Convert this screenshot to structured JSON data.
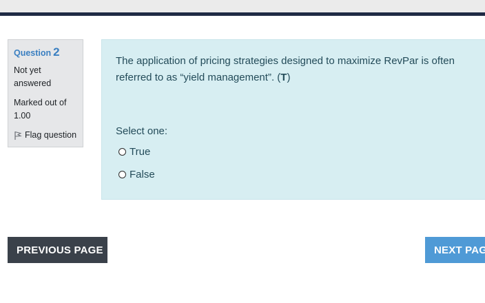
{
  "question": {
    "label": "Question",
    "number": "2",
    "state": "Not yet answered",
    "grade": "Marked out of 1.00",
    "flag_label": "Flag question",
    "text_main": "The application of pricing strategies designed to maximize RevPar is often referred to as “yield management”. (",
    "text_bold": "T",
    "text_end": ")",
    "prompt": "Select one:",
    "answers": [
      {
        "label": "True"
      },
      {
        "label": "False"
      }
    ]
  },
  "nav": {
    "prev_label": "PREVIOUS PAGE",
    "next_label": "NEXT PAGE"
  },
  "colors": {
    "accent": "#3a7fc1",
    "content_bg": "#d7eef2",
    "nav_prev": "#3a414a",
    "nav_next": "#4f9ad6",
    "header_bar": "#1f2a44"
  },
  "icons": {
    "flag": "flag-icon"
  }
}
